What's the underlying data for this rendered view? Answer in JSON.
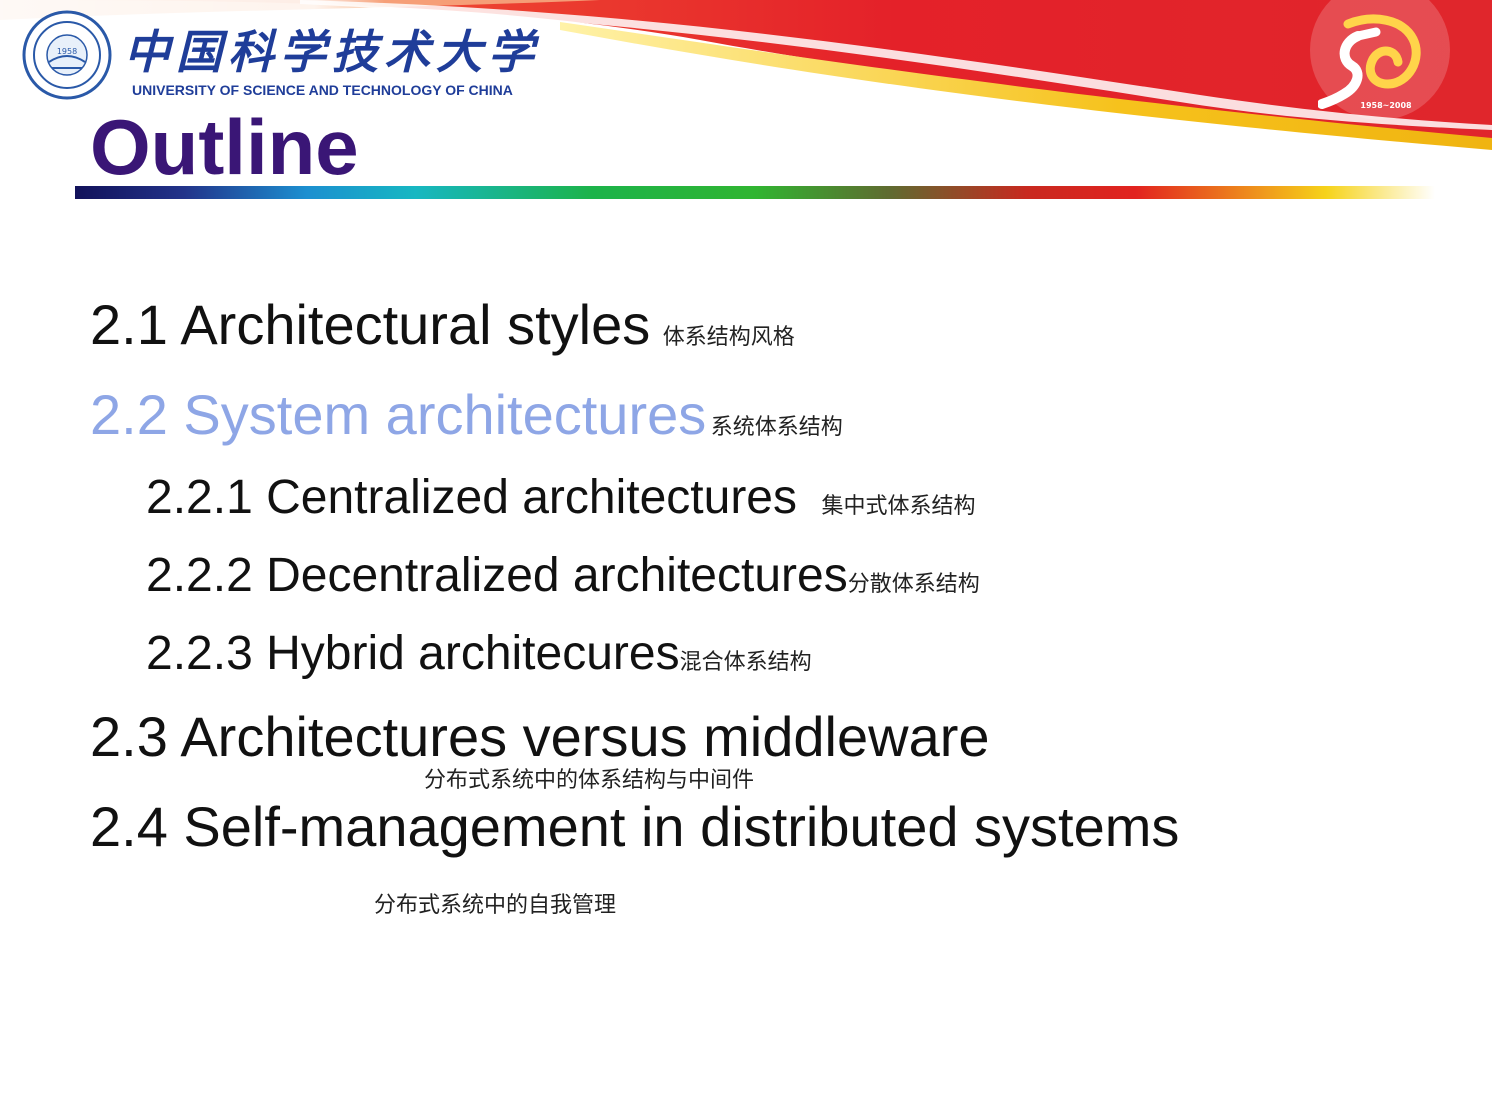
{
  "header": {
    "university_cn": "中国科学技术大学",
    "university_en": "UNIVERSITY OF SCIENCE AND TECHNOLOGY OF CHINA",
    "seal_year": "1958",
    "anniversary_years": "1958~2008",
    "colors": {
      "banner_red": "#e5262b",
      "banner_gold": "#f2c21b",
      "brand_blue": "#1f3d99"
    }
  },
  "slide": {
    "title": "Outline",
    "title_color": "#3a1676",
    "highlight_color": "#8ea6e6",
    "items": [
      {
        "text": "2.1 Architectural styles",
        "cn": "体系结构风格"
      },
      {
        "text": "2.2 System architectures",
        "cn": "系统体系结构"
      },
      {
        "text": "2.2.1 Centralized architectures",
        "cn": "集中式体系结构"
      },
      {
        "text": "2.2.2 Decentralized architectures",
        "cn": "分散体系结构"
      },
      {
        "text": "2.2.3 Hybrid architecures",
        "cn": "混合体系结构"
      },
      {
        "text": "2.3 Architectures versus middleware",
        "cn": "分布式系统中的体系结构与中间件"
      },
      {
        "text": "2.4 Self-management in distributed systems",
        "cn": "分布式系统中的自我管理"
      }
    ]
  }
}
